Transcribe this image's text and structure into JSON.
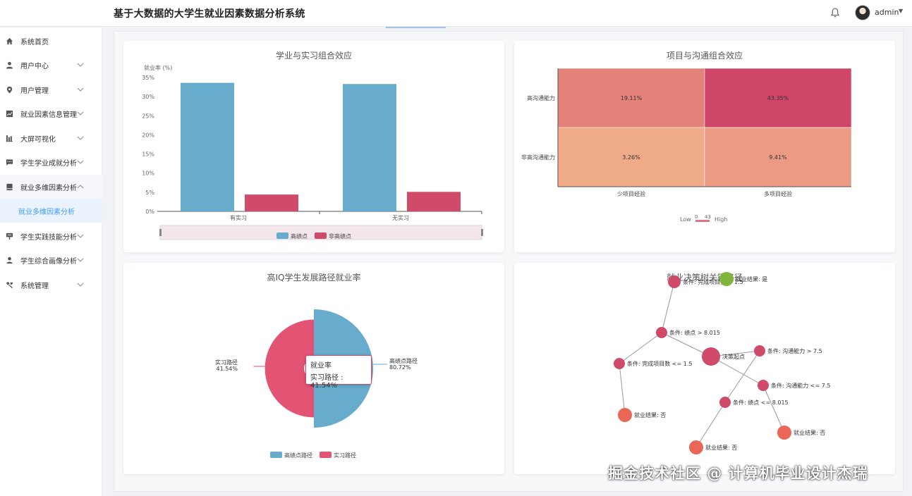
{
  "header": {
    "title": "基于大数据的大学生就业因素数据分析系统",
    "user_name": "admin"
  },
  "sidebar": {
    "items": [
      {
        "label": "系统首页",
        "icon": "home-icon"
      },
      {
        "label": "用户中心",
        "icon": "user-icon"
      },
      {
        "label": "用户管理",
        "icon": "location-icon"
      },
      {
        "label": "就业因素信息管理",
        "icon": "chart-icon"
      },
      {
        "label": "大屏可视化",
        "icon": "bar-icon"
      },
      {
        "label": "学生学业成就分析",
        "icon": "message-icon"
      },
      {
        "label": "就业多维因素分析",
        "icon": "folder-icon"
      },
      {
        "label": "学生实践技能分析",
        "icon": "tag-icon"
      },
      {
        "label": "学生综合画像分析",
        "icon": "person-icon"
      },
      {
        "label": "系统管理",
        "icon": "tools-icon"
      }
    ],
    "sub_item": "就业多维因素分析"
  },
  "cards": {
    "bar": {
      "title": "学业与实习组合效应"
    },
    "heatmap": {
      "title": "项目与沟通组合效应"
    },
    "pie": {
      "title": "高IQ学生发展路径就业率"
    },
    "tree": {
      "title": "就业决策树关键路径"
    }
  },
  "chart_data": [
    {
      "type": "bar",
      "title": "学业与实习组合效应",
      "ylabel": "就业率 (%)",
      "categories": [
        "有实习",
        "无实习"
      ],
      "ylim": [
        0,
        35
      ],
      "yticks": [
        "0%",
        "5%",
        "10%",
        "15%",
        "20%",
        "25%",
        "30%",
        "35%"
      ],
      "series": [
        {
          "name": "高绩点",
          "values": [
            33.6,
            33.3
          ],
          "color": "#67abcd"
        },
        {
          "name": "非高绩点",
          "values": [
            4.4,
            5.1
          ],
          "color": "#d04a6a"
        }
      ],
      "legend": "bottom"
    },
    {
      "type": "heatmap",
      "title": "项目与沟通组合效应",
      "x": [
        "少项目经验",
        "多项目经验"
      ],
      "y": [
        "高沟通能力",
        "非高沟通能力"
      ],
      "values": [
        [
          19.11,
          43.35
        ],
        [
          3.26,
          9.41
        ]
      ],
      "labels": [
        [
          "19.11%",
          "43.35%"
        ],
        [
          "3.26%",
          "9.41%"
        ]
      ],
      "visual_map": {
        "low": "Low",
        "high": "High",
        "min": "0",
        "max": "43"
      }
    },
    {
      "type": "pie",
      "title": "高IQ学生发展路径就业率",
      "series_name": "就业率",
      "slices": [
        {
          "name": "高绩点路径",
          "value": 80.72,
          "label": "80.72%",
          "color": "#67abcd"
        },
        {
          "name": "实习路径",
          "value": 41.54,
          "label": "41.54%",
          "color": "#e35374"
        }
      ],
      "tooltip": {
        "title": "就业率",
        "text": "实习路径 : 41.54%"
      },
      "legend": "bottom"
    }
  ],
  "tree": {
    "title": "就业决策树关键路径",
    "nodes": [
      {
        "label": "条件: 完成项目数 > 1.5"
      },
      {
        "label": "就业结果: 是"
      },
      {
        "label": "条件: 绩点 > 8.015"
      },
      {
        "label": "决策起点"
      },
      {
        "label": "条件: 沟通能力 > 7.5"
      },
      {
        "label": "条件: 完成项目数 <= 1.5"
      },
      {
        "label": "条件: 沟通能力 <= 7.5"
      },
      {
        "label": "条件: 绩点 <= 8.015"
      },
      {
        "label": "就业结果: 否"
      },
      {
        "label": "就业结果: 否"
      },
      {
        "label": "就业结果: 否"
      }
    ]
  },
  "watermark": "掘金技术社区 @ 计算机毕业设计杰瑞"
}
